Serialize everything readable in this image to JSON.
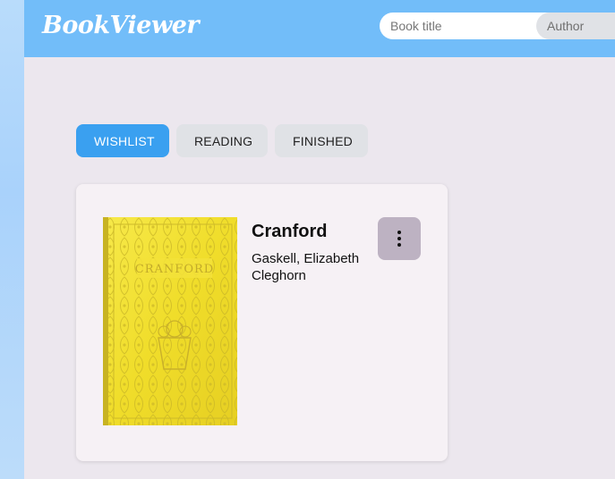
{
  "app": {
    "title": "BookViewer"
  },
  "search": {
    "title_placeholder": "Book title",
    "author_placeholder": "Author"
  },
  "tabs": [
    {
      "label": "WISHLIST",
      "active": true
    },
    {
      "label": "READING",
      "active": false
    },
    {
      "label": "FINISHED",
      "active": false
    }
  ],
  "books": [
    {
      "title": "Cranford",
      "author": "Gaskell, Elizabeth Cleghorn",
      "cover_text": "CRANFORD",
      "cover_color": "#f0dd2a"
    }
  ],
  "icons": {
    "menu": "more-vertical-icon"
  },
  "colors": {
    "topbar": "#72bdf9",
    "accent": "#3aa0f0",
    "background": "#ece7ee",
    "card": "#f6f1f5",
    "menu_button": "#bdb2c2"
  }
}
